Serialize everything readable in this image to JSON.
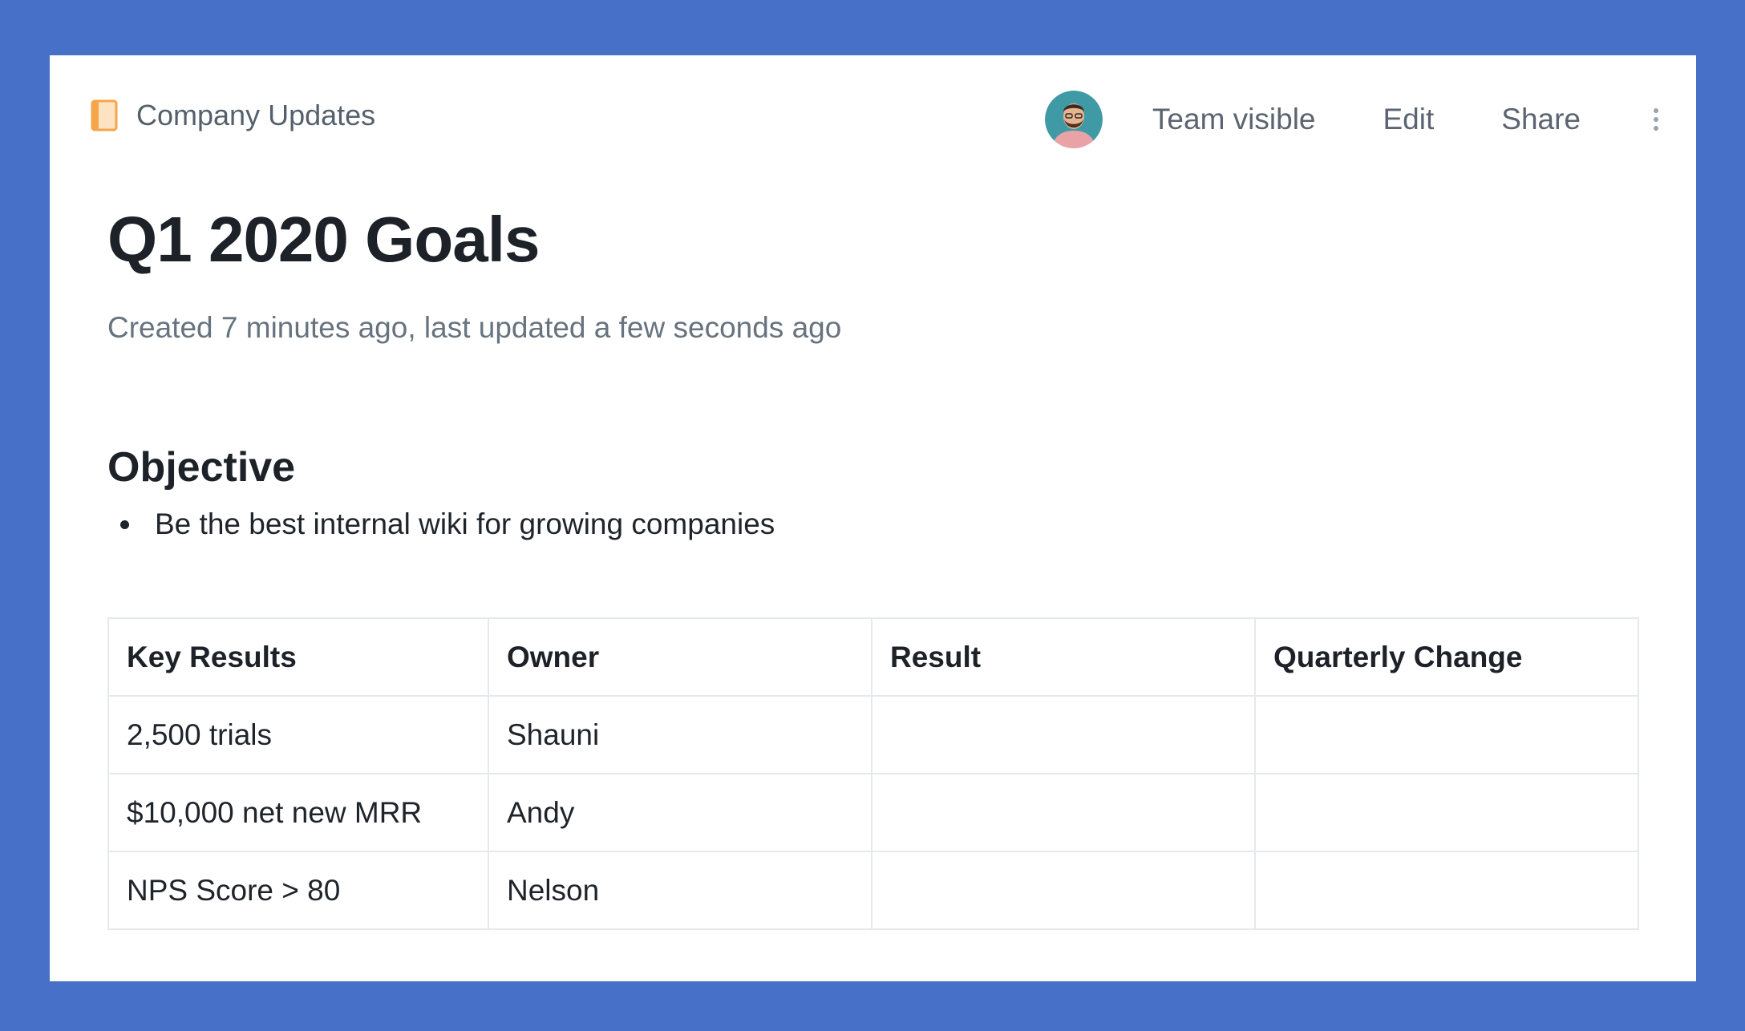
{
  "breadcrumb": {
    "collection": "Company Updates",
    "icon": "book-icon"
  },
  "header_actions": {
    "avatar": "user-avatar",
    "visibility": "Team visible",
    "edit": "Edit",
    "share": "Share",
    "more": "more-vertical-icon"
  },
  "document": {
    "title": "Q1 2020 Goals",
    "meta": "Created 7 minutes ago, last updated a few seconds ago",
    "section_heading": "Objective",
    "objectives": [
      "Be the best internal wiki for growing companies"
    ]
  },
  "table": {
    "headers": [
      "Key Results",
      "Owner",
      "Result",
      "Quarterly Change"
    ],
    "rows": [
      [
        "2,500 trials",
        "Shauni",
        "",
        ""
      ],
      [
        "$10,000 net new MRR",
        "Andy",
        "",
        ""
      ],
      [
        "NPS Score > 80",
        "Nelson",
        "",
        ""
      ]
    ]
  },
  "colors": {
    "background": "#4771c9",
    "card": "#ffffff",
    "accent_icon": "#f5a64a",
    "text_primary": "#1d2128",
    "text_secondary": "#67737f"
  }
}
